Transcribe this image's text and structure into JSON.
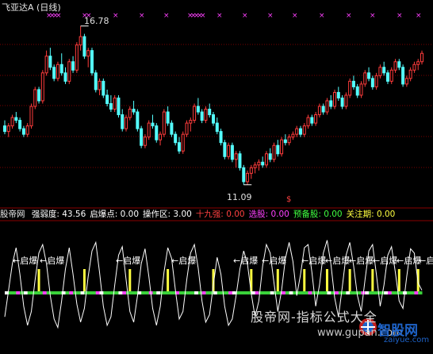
{
  "header": {
    "title": "飞亚达A (日线)",
    "high_price": "16.78",
    "low_price": "11.09",
    "signal_mark": "$"
  },
  "indicator": {
    "name": "股帝网",
    "items": [
      {
        "label": "强弱度:",
        "value": "43.56",
        "color": "#ffffff"
      },
      {
        "label": "启爆点:",
        "value": "0.00",
        "color": "#ffffff"
      },
      {
        "label": "操作区:",
        "value": "3.00",
        "color": "#ffffff"
      },
      {
        "label": "十九强:",
        "value": "0.00",
        "color": "#ff4040"
      },
      {
        "label": "选股:",
        "value": "0.00",
        "color": "#ff40ff"
      },
      {
        "label": "预备股:",
        "value": "0.00",
        "color": "#40ff40"
      },
      {
        "label": "关注期:",
        "value": "0.00",
        "color": "#ffff40"
      }
    ],
    "signal_text": "启爆"
  },
  "watermark": {
    "line1": "股帝网-指标公式大全",
    "line2": "www.gupan.com",
    "brand": "智股网",
    "brand_url": "zaiyue.com"
  },
  "colors": {
    "up": "#ff3c3c",
    "down": "#54ffff",
    "grid": "#7a0000",
    "magenta": "#ff40ff",
    "yellow": "#ffff40",
    "green": "#3ad23a"
  },
  "chart_data": [
    {
      "type": "candlestick",
      "title": "飞亚达A (日线)",
      "annotations": [
        "16.78",
        "11.09"
      ],
      "ylim": [
        10.6,
        17.2
      ],
      "candles": [
        [
          13.2,
          13.4,
          12.9,
          13.0
        ],
        [
          13.0,
          13.3,
          12.8,
          13.2
        ],
        [
          13.2,
          13.6,
          13.1,
          13.5
        ],
        [
          13.5,
          13.7,
          13.3,
          13.4
        ],
        [
          13.4,
          13.5,
          13.0,
          13.1
        ],
        [
          13.1,
          13.2,
          12.8,
          12.9
        ],
        [
          12.9,
          13.3,
          12.8,
          13.2
        ],
        [
          13.2,
          14.0,
          13.1,
          13.9
        ],
        [
          13.9,
          14.6,
          13.8,
          14.5
        ],
        [
          14.5,
          14.6,
          14.0,
          14.1
        ],
        [
          14.1,
          15.2,
          14.0,
          15.1
        ],
        [
          15.1,
          15.9,
          15.0,
          15.7
        ],
        [
          15.7,
          16.0,
          15.2,
          15.3
        ],
        [
          15.3,
          15.4,
          14.8,
          14.9
        ],
        [
          14.9,
          15.5,
          14.8,
          15.4
        ],
        [
          15.4,
          15.8,
          15.0,
          15.1
        ],
        [
          15.1,
          15.3,
          14.7,
          14.8
        ],
        [
          14.8,
          15.6,
          14.7,
          15.5
        ],
        [
          15.5,
          15.7,
          15.1,
          15.2
        ],
        [
          15.2,
          16.2,
          15.1,
          16.1
        ],
        [
          16.1,
          16.78,
          15.9,
          16.4
        ],
        [
          16.4,
          16.5,
          15.6,
          15.7
        ],
        [
          15.7,
          16.0,
          15.3,
          15.9
        ],
        [
          15.9,
          16.0,
          15.0,
          15.1
        ],
        [
          15.1,
          15.2,
          14.4,
          14.5
        ],
        [
          14.5,
          14.9,
          14.3,
          14.8
        ],
        [
          14.8,
          14.9,
          14.2,
          14.3
        ],
        [
          14.3,
          14.5,
          13.9,
          14.0
        ],
        [
          14.0,
          14.3,
          13.7,
          13.8
        ],
        [
          13.8,
          14.3,
          13.7,
          14.2
        ],
        [
          14.2,
          14.3,
          13.5,
          13.6
        ],
        [
          13.6,
          13.8,
          13.0,
          13.1
        ],
        [
          13.1,
          13.6,
          13.0,
          13.5
        ],
        [
          13.5,
          13.9,
          13.4,
          13.8
        ],
        [
          13.8,
          14.1,
          13.6,
          13.7
        ],
        [
          13.7,
          13.8,
          13.0,
          13.1
        ],
        [
          13.1,
          13.2,
          12.4,
          12.5
        ],
        [
          12.5,
          12.9,
          12.4,
          12.8
        ],
        [
          12.8,
          13.4,
          12.7,
          13.3
        ],
        [
          13.3,
          13.6,
          13.1,
          13.2
        ],
        [
          13.2,
          13.3,
          12.6,
          12.7
        ],
        [
          12.7,
          13.0,
          12.5,
          12.9
        ],
        [
          12.9,
          13.8,
          12.8,
          13.7
        ],
        [
          13.7,
          13.9,
          13.2,
          13.3
        ],
        [
          13.3,
          13.4,
          12.8,
          12.9
        ],
        [
          12.9,
          13.0,
          12.5,
          12.6
        ],
        [
          12.6,
          12.8,
          12.2,
          12.3
        ],
        [
          12.3,
          13.0,
          12.2,
          12.9
        ],
        [
          12.9,
          13.4,
          12.8,
          13.3
        ],
        [
          13.3,
          13.5,
          13.0,
          13.4
        ],
        [
          13.4,
          14.0,
          13.3,
          13.9
        ],
        [
          13.9,
          14.2,
          13.6,
          13.7
        ],
        [
          13.7,
          13.8,
          13.3,
          13.4
        ],
        [
          13.4,
          13.9,
          13.3,
          13.8
        ],
        [
          13.8,
          14.0,
          13.5,
          13.6
        ],
        [
          13.6,
          13.7,
          13.2,
          13.3
        ],
        [
          13.3,
          13.5,
          12.9,
          13.0
        ],
        [
          13.0,
          13.1,
          12.5,
          12.6
        ],
        [
          12.6,
          12.7,
          12.0,
          12.1
        ],
        [
          12.1,
          12.6,
          12.0,
          12.5
        ],
        [
          12.5,
          12.6,
          11.9,
          12.0
        ],
        [
          12.0,
          12.3,
          11.7,
          12.2
        ],
        [
          12.2,
          12.3,
          11.6,
          11.7
        ],
        [
          11.7,
          11.8,
          11.09,
          11.2
        ],
        [
          11.2,
          11.6,
          11.1,
          11.5
        ],
        [
          11.5,
          11.8,
          11.3,
          11.7
        ],
        [
          11.7,
          11.9,
          11.5,
          11.8
        ],
        [
          11.8,
          12.0,
          11.6,
          11.9
        ],
        [
          11.9,
          12.1,
          11.7,
          11.8
        ],
        [
          11.8,
          12.3,
          11.7,
          12.2
        ],
        [
          12.2,
          12.4,
          11.9,
          12.0
        ],
        [
          12.0,
          12.6,
          11.9,
          12.5
        ],
        [
          12.5,
          12.7,
          12.1,
          12.2
        ],
        [
          12.2,
          12.8,
          12.1,
          12.7
        ],
        [
          12.7,
          12.9,
          12.5,
          12.6
        ],
        [
          12.6,
          12.9,
          12.5,
          12.8
        ],
        [
          12.8,
          13.0,
          12.7,
          12.9
        ],
        [
          12.9,
          13.2,
          12.8,
          13.1
        ],
        [
          13.1,
          13.2,
          12.8,
          12.9
        ],
        [
          12.9,
          13.3,
          12.8,
          13.2
        ],
        [
          13.2,
          13.6,
          13.1,
          13.5
        ],
        [
          13.5,
          13.6,
          13.2,
          13.3
        ],
        [
          13.3,
          13.7,
          13.2,
          13.6
        ],
        [
          13.6,
          14.0,
          13.5,
          13.9
        ],
        [
          13.9,
          14.0,
          13.6,
          13.7
        ],
        [
          13.7,
          14.2,
          13.6,
          14.1
        ],
        [
          14.1,
          14.3,
          13.8,
          13.9
        ],
        [
          13.9,
          14.5,
          13.8,
          14.4
        ],
        [
          14.4,
          14.6,
          14.1,
          14.2
        ],
        [
          14.2,
          14.3,
          13.8,
          13.9
        ],
        [
          13.9,
          14.4,
          13.8,
          14.3
        ],
        [
          14.3,
          14.9,
          14.2,
          14.8
        ],
        [
          14.8,
          15.0,
          14.5,
          14.6
        ],
        [
          14.6,
          14.7,
          14.2,
          14.3
        ],
        [
          14.3,
          14.8,
          14.2,
          14.7
        ],
        [
          14.7,
          15.2,
          14.6,
          15.1
        ],
        [
          15.1,
          15.3,
          14.8,
          14.9
        ],
        [
          14.9,
          15.0,
          14.5,
          14.6
        ],
        [
          14.6,
          15.1,
          14.5,
          15.0
        ],
        [
          15.0,
          15.4,
          14.9,
          15.3
        ],
        [
          15.3,
          15.5,
          15.0,
          15.1
        ],
        [
          15.1,
          15.2,
          14.7,
          14.8
        ],
        [
          14.8,
          15.3,
          14.7,
          15.2
        ],
        [
          15.2,
          15.6,
          15.1,
          15.5
        ],
        [
          15.5,
          15.6,
          15.2,
          15.3
        ],
        [
          15.3,
          15.4,
          14.6,
          14.7
        ],
        [
          14.7,
          15.0,
          14.6,
          14.9
        ],
        [
          14.9,
          15.3,
          14.8,
          15.2
        ],
        [
          15.2,
          15.5,
          15.1,
          15.4
        ],
        [
          15.4,
          15.6,
          15.2,
          15.5
        ],
        [
          15.5,
          15.9,
          15.4,
          15.8
        ]
      ]
    },
    {
      "type": "line",
      "series": [
        {
          "name": "强弱度",
          "values": [
            20,
            45,
            70,
            85,
            60,
            30,
            12,
            25,
            55,
            80,
            88,
            70,
            40,
            18,
            10,
            35,
            65,
            85,
            60,
            32,
            15,
            28,
            58,
            82,
            90,
            62,
            30,
            12,
            20,
            50,
            78,
            86,
            55,
            25,
            15,
            40,
            70,
            84,
            58,
            28,
            12,
            30,
            62,
            85,
            75,
            45,
            18,
            25,
            55,
            80,
            88,
            66,
            35,
            15,
            22,
            50,
            76,
            60,
            30,
            12,
            18,
            40,
            65,
            82,
            70,
            42,
            20,
            35,
            68,
            88,
            80,
            52,
            25,
            45,
            75,
            90,
            72,
            40,
            60,
            85,
            88,
            62,
            30,
            50,
            80,
            92,
            70,
            38,
            20,
            48,
            78,
            90,
            68,
            40,
            25,
            55,
            82,
            88,
            60,
            30,
            50,
            78,
            86,
            62,
            35,
            28,
            58,
            84,
            80,
            52,
            45
          ]
        }
      ],
      "ylim": [
        0,
        100
      ]
    }
  ]
}
